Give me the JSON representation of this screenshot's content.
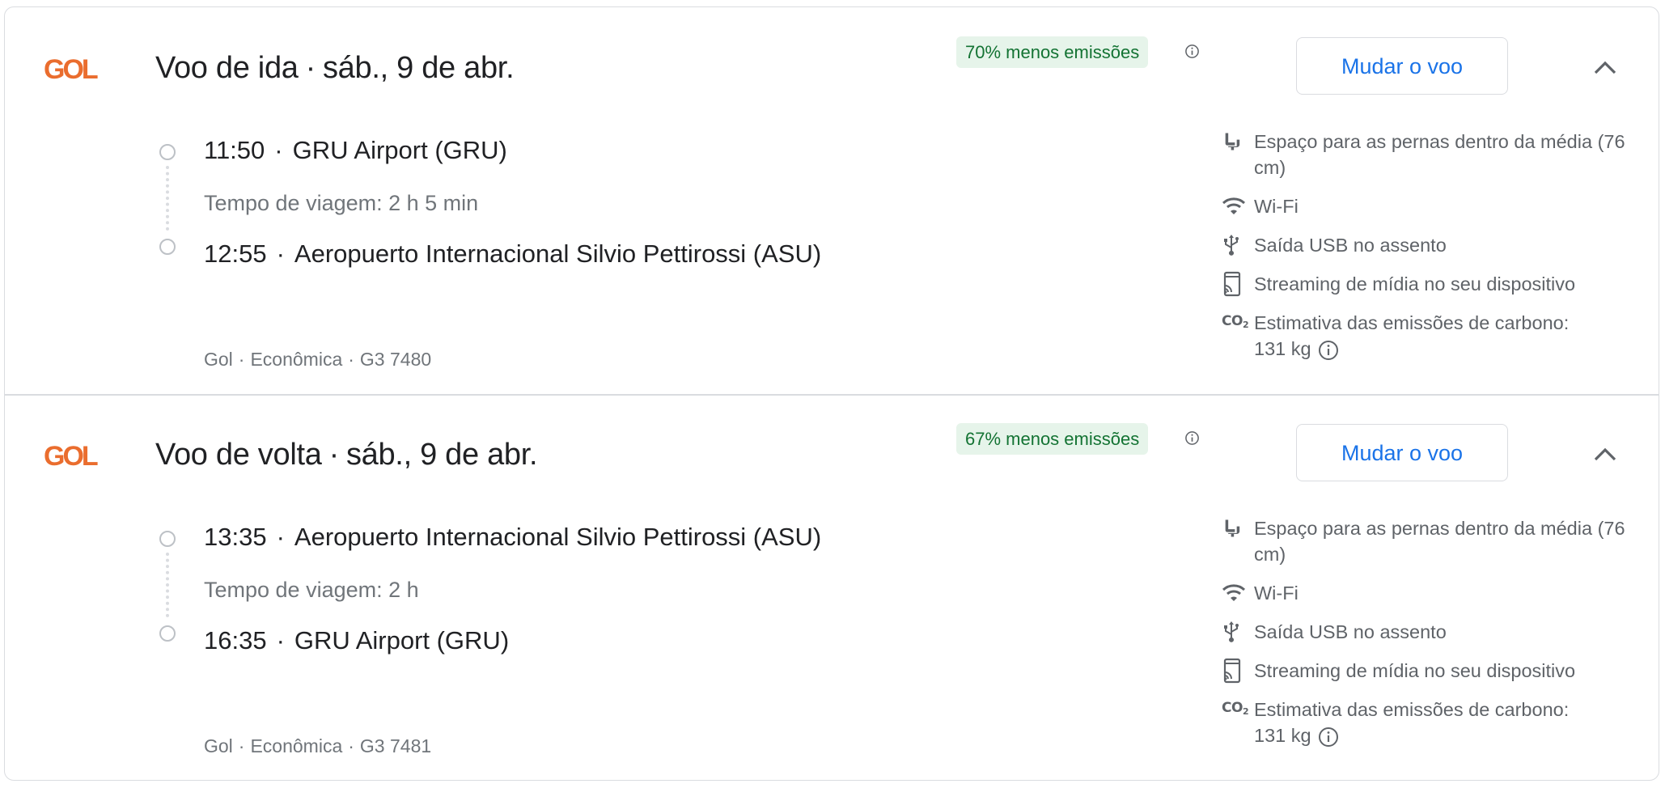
{
  "flights": [
    {
      "airline_logo_text": "GOL",
      "direction": "Voo de ida",
      "date": "sáb., 9 de abr.",
      "emissions_badge": "70% menos emissões",
      "change_label": "Mudar o voo",
      "departure_time": "11:50",
      "departure_airport": "GRU Airport (GRU)",
      "travel_time": "Tempo de viagem: 2 h 5 min",
      "arrival_time": "12:55",
      "arrival_airport": "Aeropuerto Internacional Silvio Pettirossi (ASU)",
      "airline": "Gol",
      "cabin": "Econômica",
      "flight_number": "G3 7480",
      "amenities": {
        "legroom": "Espaço para as pernas dentro da média (76 cm)",
        "wifi": "Wi-Fi",
        "usb": "Saída USB no assento",
        "streaming": "Streaming de mídia no seu dispositivo",
        "carbon_label": "Estimativa das emissões de carbono:",
        "carbon_value": "131 kg"
      }
    },
    {
      "airline_logo_text": "GOL",
      "direction": "Voo de volta",
      "date": "sáb., 9 de abr.",
      "emissions_badge": "67% menos emissões",
      "change_label": "Mudar o voo",
      "departure_time": "13:35",
      "departure_airport": "Aeropuerto Internacional Silvio Pettirossi (ASU)",
      "travel_time": "Tempo de viagem: 2 h",
      "arrival_time": "16:35",
      "arrival_airport": "GRU Airport (GRU)",
      "airline": "Gol",
      "cabin": "Econômica",
      "flight_number": "G3 7481",
      "amenities": {
        "legroom": "Espaço para as pernas dentro da média (76 cm)",
        "wifi": "Wi-Fi",
        "usb": "Saída USB no assento",
        "streaming": "Streaming de mídia no seu dispositivo",
        "carbon_label": "Estimativa das emissões de carbono:",
        "carbon_value": "131 kg"
      }
    }
  ],
  "separator": "·",
  "co2_icon_text": "CO",
  "co2_icon_sub": "2",
  "icons": {
    "seat": "seat-icon",
    "wifi": "wifi-icon",
    "usb": "usb-icon",
    "streaming": "cast-icon",
    "co2": "co2-icon",
    "info": "info-icon",
    "collapse": "chevron-up-icon"
  },
  "colors": {
    "brand_orange": "#ea6d2e",
    "emissions_bg": "#e6f4ea",
    "emissions_text": "#137333",
    "button_text": "#1a73e8",
    "border": "#dadce0",
    "secondary_text": "#70757a"
  }
}
